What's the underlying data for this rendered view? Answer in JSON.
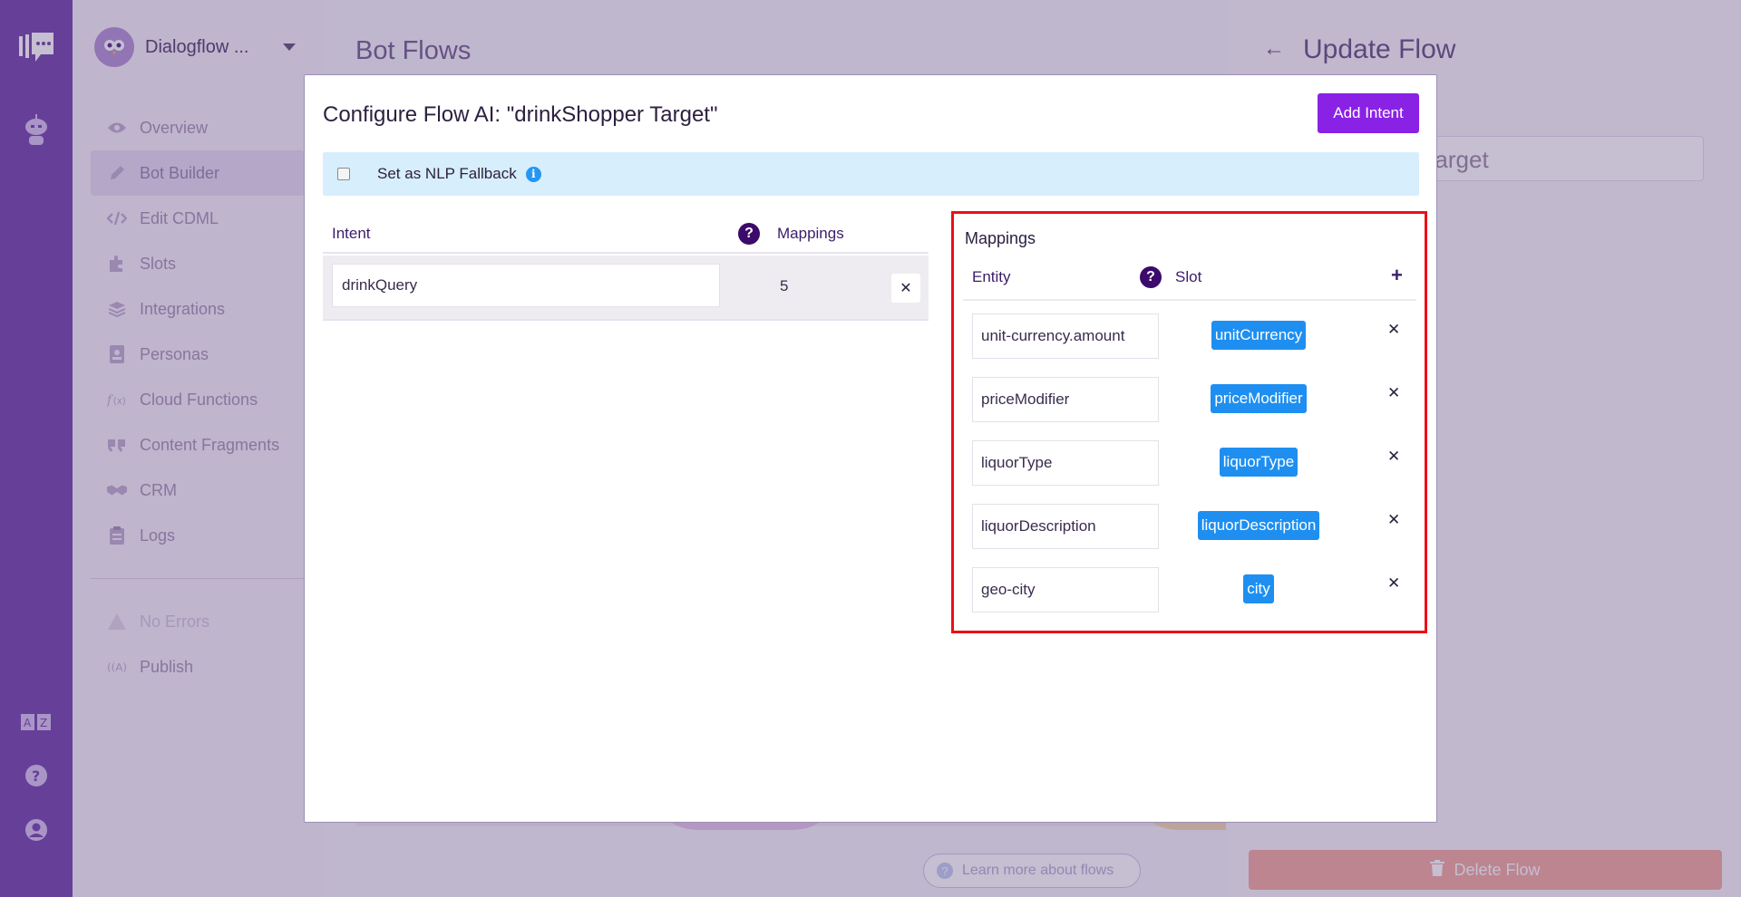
{
  "app": {
    "workspace_name": "Dialogflow ...",
    "nav": [
      {
        "label": "Overview",
        "icon": "eye-icon"
      },
      {
        "label": "Bot Builder",
        "icon": "pencil-icon"
      },
      {
        "label": "Edit CDML",
        "icon": "code-icon"
      },
      {
        "label": "Slots",
        "icon": "puzzle-icon"
      },
      {
        "label": "Integrations",
        "icon": "layers-icon"
      },
      {
        "label": "Personas",
        "icon": "id-card-icon"
      },
      {
        "label": "Cloud Functions",
        "icon": "function-icon"
      },
      {
        "label": "Content Fragments",
        "icon": "quote-icon"
      },
      {
        "label": "CRM",
        "icon": "handshake-icon"
      },
      {
        "label": "Logs",
        "icon": "clipboard-icon"
      }
    ],
    "status": {
      "label": "No Errors",
      "icon": "warning-icon"
    },
    "publish": {
      "label": "Publish",
      "icon": "broadcast-icon"
    }
  },
  "main": {
    "title": "Bot Flows",
    "learn_more": "Learn more about flows"
  },
  "update_flow": {
    "title": "Update Flow",
    "name_value": "drinkShopper Target",
    "visible_name_fragment": "opper Target",
    "delete_label": "Delete Flow"
  },
  "modal": {
    "title": "Configure Flow AI: \"drinkShopper Target\"",
    "add_intent_label": "Add Intent",
    "fallback_label": "Set as NLP Fallback",
    "fallback_checked": false,
    "intent_table": {
      "col_intent": "Intent",
      "col_mappings": "Mappings",
      "rows": [
        {
          "intent": "drinkQuery",
          "mappings": "5"
        }
      ]
    },
    "mappings_panel": {
      "title": "Mappings",
      "col_entity": "Entity",
      "col_slot": "Slot",
      "add_symbol": "+",
      "rows": [
        {
          "entity": "unit-currency.amount",
          "slot": "unitCurrency"
        },
        {
          "entity": "priceModifier",
          "slot": "priceModifier"
        },
        {
          "entity": "liquorType",
          "slot": "liquorType"
        },
        {
          "entity": "liquorDescription",
          "slot": "liquorDescription"
        },
        {
          "entity": "geo-city",
          "slot": "city"
        }
      ]
    }
  },
  "colors": {
    "rail": "#7a50b0",
    "accent_button": "#8a22e6",
    "slot_chip": "#1e8ff1",
    "highlight_border": "#ea1016",
    "info_bar": "#d7eefc"
  }
}
